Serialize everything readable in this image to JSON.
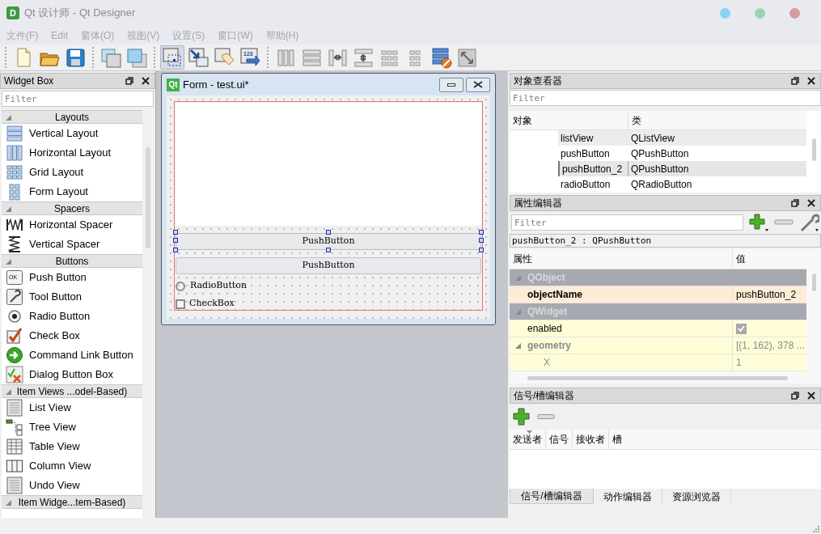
{
  "window": {
    "icon_letter": "D",
    "title": "Qt 设计师 - Qt Designer",
    "controls": [
      {
        "color": "#87d5f3"
      },
      {
        "color": "#9bd3b4"
      },
      {
        "color": "#d79ca0"
      }
    ]
  },
  "menu": [
    "文件(F)",
    "Edit",
    "窗体(O)",
    "视图(V)",
    "设置(S)",
    "窗口(W)",
    "帮助(H)"
  ],
  "toolbar": [
    [
      {
        "kind": "new",
        "selected": false
      },
      {
        "kind": "open",
        "selected": false
      },
      {
        "kind": "save",
        "selected": false
      }
    ],
    [
      {
        "kind": "back",
        "selected": false
      },
      {
        "kind": "front",
        "selected": false
      }
    ],
    [
      {
        "kind": "edit_widgets",
        "selected": true
      },
      {
        "kind": "signals",
        "selected": false
      },
      {
        "kind": "buddies",
        "selected": false
      },
      {
        "kind": "tab_order",
        "selected": false,
        "icon_text": "123"
      }
    ],
    [
      {
        "kind": "hlayout",
        "selected": false
      },
      {
        "kind": "vlayout",
        "selected": false
      },
      {
        "kind": "hsplit",
        "selected": false
      },
      {
        "kind": "vsplit",
        "selected": false
      },
      {
        "kind": "grid",
        "selected": false
      },
      {
        "kind": "form",
        "selected": false
      },
      {
        "kind": "break",
        "selected": false
      },
      {
        "kind": "adjust",
        "selected": false
      }
    ]
  ],
  "widget_box": {
    "title": "Widget Box",
    "filter_placeholder": "Filter",
    "categories": [
      {
        "label": "Layouts",
        "expanded": true,
        "items": [
          {
            "label": "Vertical Layout",
            "kind": "vlayout"
          },
          {
            "label": "Horizontal Layout",
            "kind": "hlayout"
          },
          {
            "label": "Grid Layout",
            "kind": "grid"
          },
          {
            "label": "Form Layout",
            "kind": "form"
          }
        ]
      },
      {
        "label": "Spacers",
        "expanded": true,
        "items": [
          {
            "label": "Horizontal Spacer",
            "kind": "hspacer"
          },
          {
            "label": "Vertical Spacer",
            "kind": "vspacer"
          }
        ]
      },
      {
        "label": "Buttons",
        "expanded": true,
        "items": [
          {
            "label": "Push Button",
            "kind": "push",
            "icon_text": "OK"
          },
          {
            "label": "Tool Button",
            "kind": "tool"
          },
          {
            "label": "Radio Button",
            "kind": "radio"
          },
          {
            "label": "Check Box",
            "kind": "check"
          },
          {
            "label": "Command Link Button",
            "kind": "command"
          },
          {
            "label": "Dialog Button Box",
            "kind": "dialog"
          }
        ]
      },
      {
        "label": "Item Views ...odel-Based)",
        "expanded": true,
        "items": [
          {
            "label": "List View",
            "kind": "list"
          },
          {
            "label": "Tree View",
            "kind": "tree"
          },
          {
            "label": "Table View",
            "kind": "table"
          },
          {
            "label": "Column View",
            "kind": "column"
          },
          {
            "label": "Undo View",
            "kind": "list"
          }
        ]
      },
      {
        "label": "Item Widge...tem-Based)",
        "expanded": true
      }
    ]
  },
  "form": {
    "icon_text": "Qt",
    "title": "Form - test.ui*",
    "buttons": [
      {
        "label": "PushButton",
        "selected": true
      },
      {
        "label": "PushButton",
        "selected": false
      }
    ],
    "radio": {
      "label": "RadioButton",
      "checked": false
    },
    "checkbox": {
      "label": "CheckBox",
      "checked": false
    }
  },
  "object_inspector": {
    "title": "对象查看器",
    "filter_placeholder": "Filter",
    "columns": [
      "对象",
      "类"
    ],
    "rows": [
      {
        "object": "listView",
        "class": "QListView",
        "selected": false
      },
      {
        "object": "pushButton",
        "class": "QPushButton",
        "selected": false
      },
      {
        "object": "pushButton_2",
        "class": "QPushButton",
        "selected": true
      },
      {
        "object": "radioButton",
        "class": "QRadioButton",
        "selected": false
      }
    ]
  },
  "property_editor": {
    "title": "属性编辑器",
    "filter_placeholder": "Filter",
    "object_label": "pushButton_2 : QPushButton",
    "columns": [
      "属性",
      "值"
    ],
    "groups": [
      {
        "name": "QObject",
        "expanded": true,
        "color": "#fdecd6",
        "properties": [
          {
            "name": "objectName",
            "value": "pushButton_2",
            "kind": "text",
            "changed": true
          }
        ]
      },
      {
        "name": "QWidget",
        "expanded": true,
        "color": "#fffdd8",
        "properties": [
          {
            "name": "enabled",
            "kind": "bool",
            "checked": true,
            "changed": false
          },
          {
            "name": "geometry",
            "value": "[(1, 162), 378 ...",
            "kind": "text",
            "changed": false,
            "expanded": true,
            "children": [
              {
                "name": "X",
                "value": "1",
                "kind": "text",
                "changed": false
              }
            ]
          }
        ]
      }
    ]
  },
  "signal_slot_editor": {
    "title": "信号/槽编辑器",
    "columns": [
      "发送者",
      "信号",
      "接收者",
      "槽"
    ]
  },
  "bottom_tabs": [
    {
      "label": "信号/槽编辑器",
      "selected": true
    },
    {
      "label": "动作编辑器",
      "selected": false
    },
    {
      "label": "资源浏览器",
      "selected": false
    }
  ]
}
